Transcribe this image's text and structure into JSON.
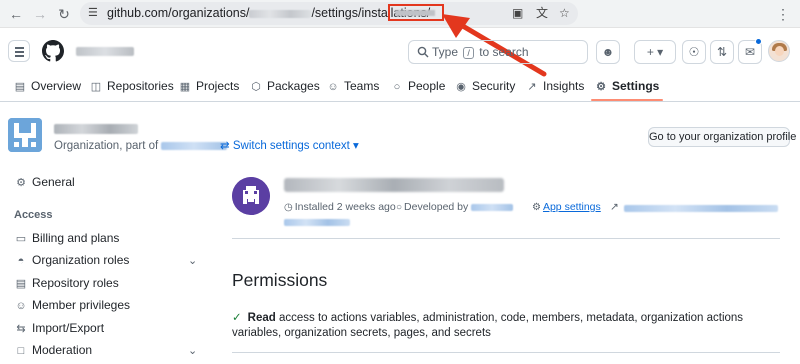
{
  "browser": {
    "url_prefix": "github.com/organizations/",
    "url_middle": "/settings/installations/",
    "back_icon": "arrow-left-icon",
    "forward_icon": "arrow-right-icon",
    "reload_icon": "reload-icon",
    "highlight_color": "#e3371e"
  },
  "header": {
    "search_prefix": "Type",
    "search_key": "/",
    "search_suffix": "to search",
    "new_label": "+"
  },
  "tabs": [
    {
      "label": "Overview",
      "icon": "book-icon"
    },
    {
      "label": "Repositories",
      "icon": "repo-icon"
    },
    {
      "label": "Projects",
      "icon": "table-icon"
    },
    {
      "label": "Packages",
      "icon": "package-icon"
    },
    {
      "label": "Teams",
      "icon": "people-icon"
    },
    {
      "label": "People",
      "icon": "person-icon"
    },
    {
      "label": "Security",
      "icon": "shield-icon"
    },
    {
      "label": "Insights",
      "icon": "graph-icon"
    },
    {
      "label": "Settings",
      "icon": "gear-icon"
    }
  ],
  "org": {
    "subtitle_prefix": "Organization, part of",
    "switch_context": "Switch settings context",
    "profile_button": "Go to your organization profile"
  },
  "sidebar": {
    "general": "General",
    "access_heading": "Access",
    "items": [
      {
        "label": "Billing and plans",
        "icon": "credit-card-icon"
      },
      {
        "label": "Organization roles",
        "icon": "roles-icon",
        "expandable": true
      },
      {
        "label": "Repository roles",
        "icon": "repo-roles-icon"
      },
      {
        "label": "Member privileges",
        "icon": "people-icon"
      },
      {
        "label": "Import/Export",
        "icon": "arrow-switch-icon"
      },
      {
        "label": "Moderation",
        "icon": "report-icon",
        "expandable": true
      }
    ]
  },
  "app": {
    "installed": "Installed 2 weeks ago",
    "developed_by": "Developed by",
    "app_settings": "App settings"
  },
  "permissions": {
    "title": "Permissions",
    "read_label": "Read",
    "read_text": "access to actions variables, administration, code, members, metadata, organization actions variables, organization secrets, pages, and secrets"
  }
}
